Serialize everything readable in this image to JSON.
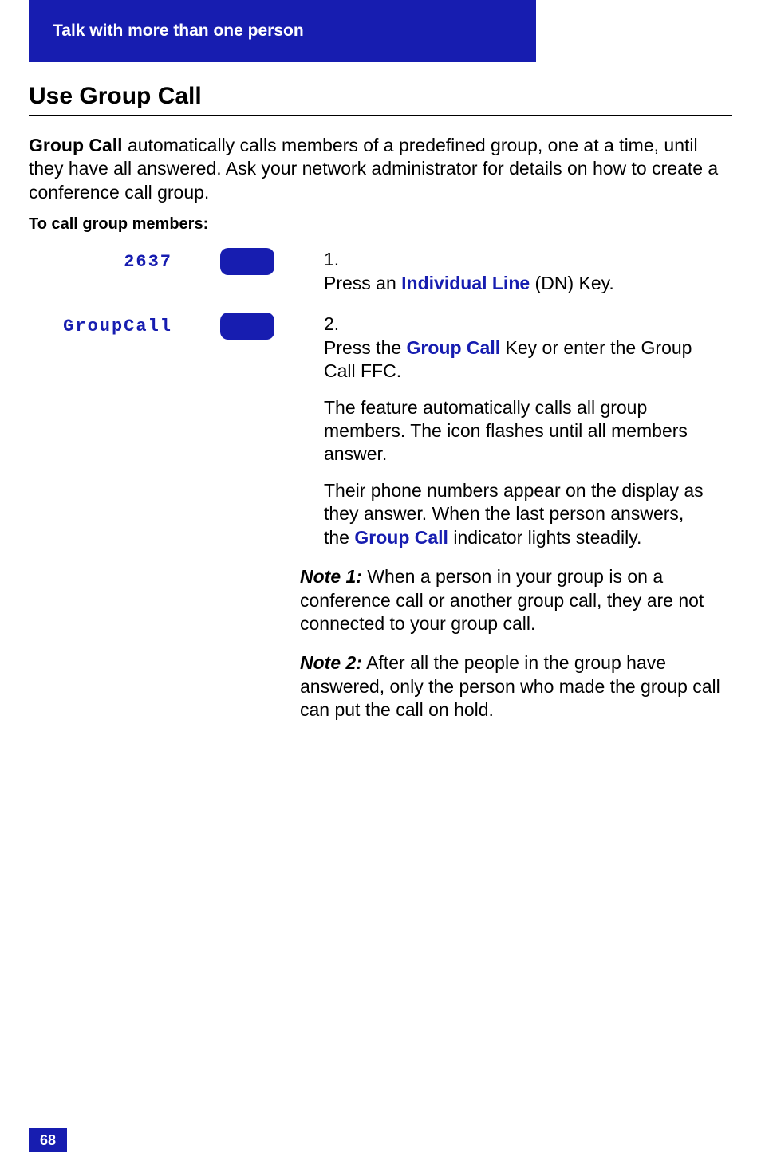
{
  "header": {
    "title": "Talk with more than one person"
  },
  "section": {
    "heading": "Use Group Call",
    "intro_bold": "Group Call",
    "intro_rest": " automatically calls members of a predefined group, one at a time, until they have all answered. Ask your network administrator for details on how to create a conference call group.",
    "subhead": "To call group members:"
  },
  "steps": [
    {
      "key_label": "2637",
      "num": "1.",
      "pre": "Press an ",
      "hl": "Individual Line",
      "post": " (DN) Key."
    },
    {
      "key_label": "GroupCall",
      "num": "2.",
      "pre": "Press the ",
      "hl": "Group Call",
      "post": " Key or enter the Group Call FFC.",
      "para2": "The feature automatically calls all group members. The icon flashes until all members answer.",
      "para3_pre": "Their phone numbers appear on the display as they answer. When the last person answers, the ",
      "para3_hl": "Group Call",
      "para3_post": " indicator lights steadily."
    }
  ],
  "notes": [
    {
      "label": "Note 1:",
      "text": "  When a person in your group is on a conference call or another group call, they are not connected to your group call."
    },
    {
      "label": "Note 2:",
      "text": "   After all the people in the group have answered, only the person who made the group call can put the call on hold."
    }
  ],
  "page": "68"
}
